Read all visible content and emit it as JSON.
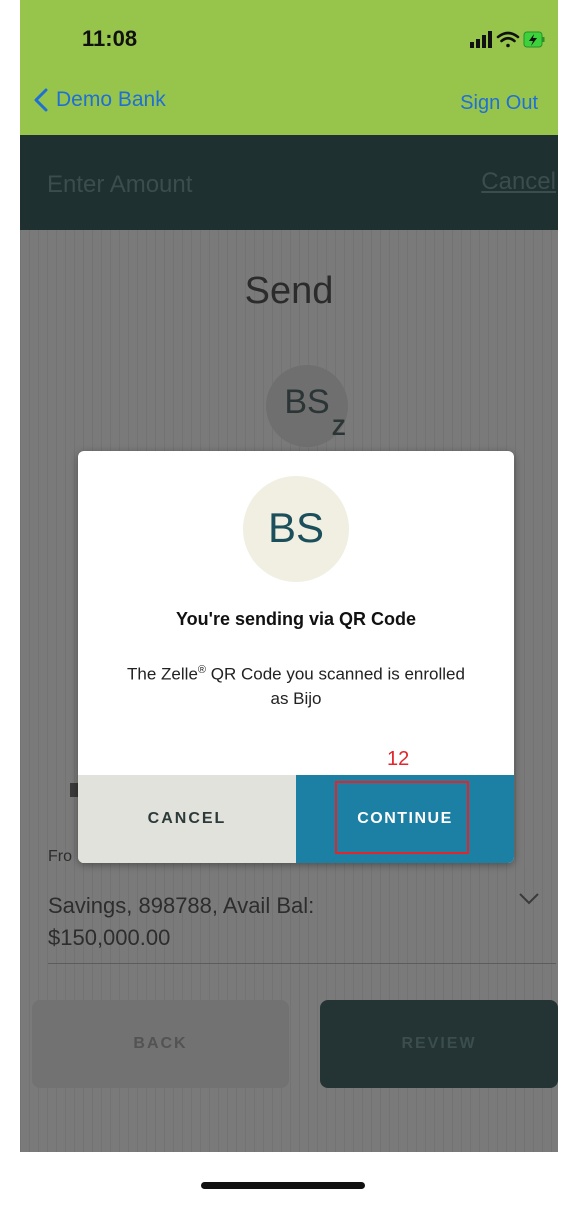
{
  "status_bar": {
    "time": "11:08"
  },
  "nav": {
    "back_label": "Demo Bank",
    "sign_out": "Sign Out"
  },
  "header": {
    "title": "Enter Amount",
    "cancel": "Cancel"
  },
  "page": {
    "title": "Send",
    "recipient_initials": "BS",
    "zelle_glyph": "Z",
    "from_label": "Fro",
    "account": {
      "line1": "Savings, 898788, Avail Bal:",
      "line2": "$150,000.00"
    },
    "back_button": "BACK",
    "review_button": "REVIEW"
  },
  "modal": {
    "initials": "BS",
    "title": "You're sending via QR Code",
    "message_prefix": "The Zelle",
    "message_mark": "®",
    "message_suffix": " QR Code you scanned is enrolled as Bijo",
    "cancel_button": "CANCEL",
    "continue_button": "CONTINUE"
  },
  "annotation": {
    "number": "12",
    "color": "#e3242b"
  },
  "colors": {
    "topbar": "#97c54b",
    "header": "#1e3030",
    "continue": "#1c7fa4",
    "link": "#1f6fd6"
  }
}
